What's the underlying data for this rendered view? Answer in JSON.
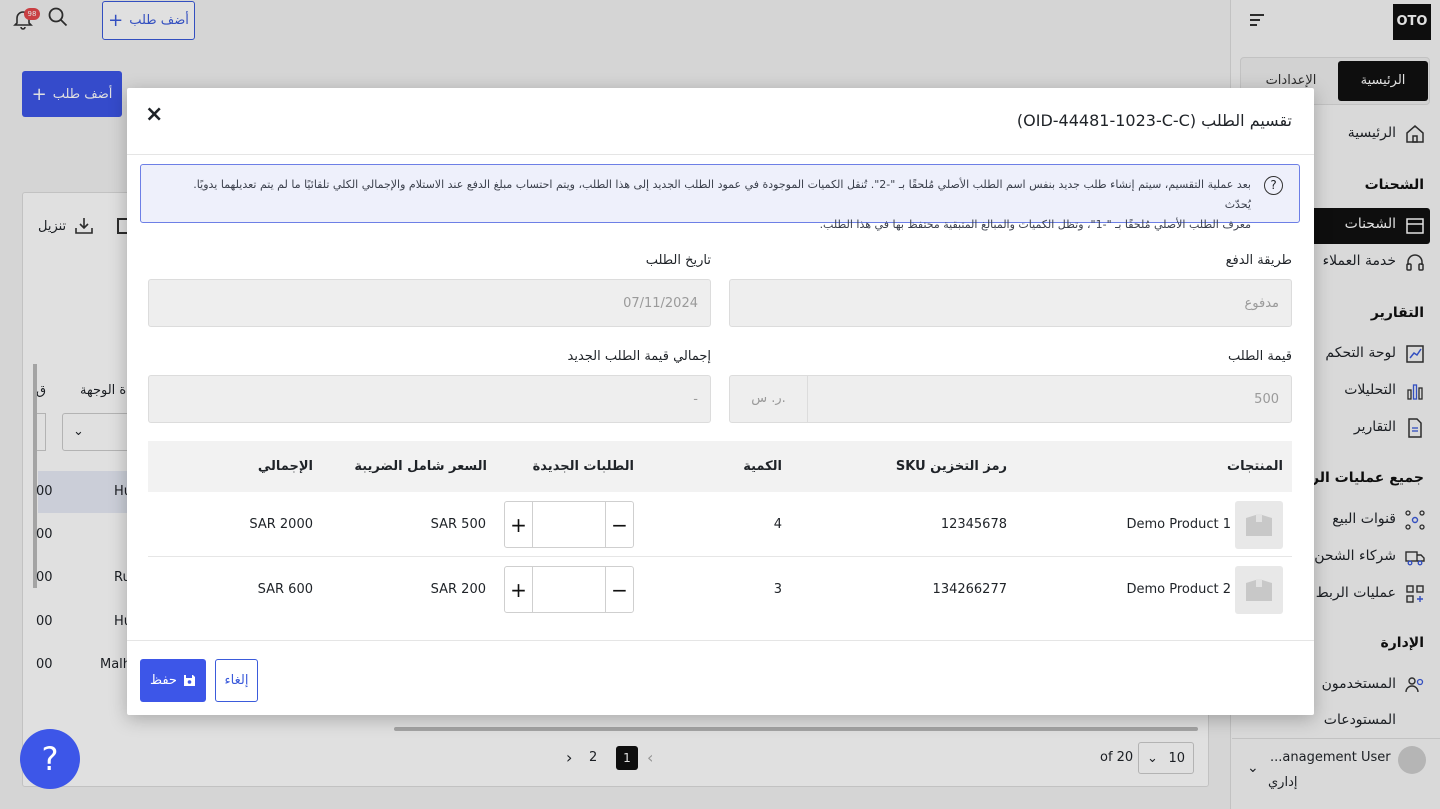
{
  "topbar": {
    "notif_count": "98",
    "add_order": "أضف طلب"
  },
  "sidebar": {
    "logo": "OTO",
    "tabs": [
      "الرئيسية",
      "الإعدادات"
    ],
    "home": "الرئيسية",
    "shipments_head": "الشحنات",
    "shipments": "الشحنات",
    "support": "خدمة العملاء",
    "reports_head": "التقارير",
    "dashboard": "لوحة التحكم",
    "analytics": "التحليلات",
    "reports": "التقارير",
    "integrations_head": "جميع عمليات الربط",
    "sales_channels": "قنوات البيع",
    "shipping_partners": "شركاء الشحن",
    "integration_ops": "عمليات الربط ا",
    "admin_head": "الإدارة",
    "users": "المستخدمون",
    "more": "المستودعات",
    "user_name": "...anagement User",
    "user_role": "إداري"
  },
  "background": {
    "add_order": "أضف طلب",
    "download": "تنزيل",
    "destination_col": "ة الوجهة",
    "partial_col": "ق",
    "rows": [
      "Hurayr",
      "",
      "Rugha",
      "Hurayr",
      "Malh"
    ],
    "row_amounts": [
      "00",
      "00",
      "00",
      "00",
      "00"
    ],
    "per_page": "10",
    "of_total": "of 20",
    "pages": [
      "1",
      "2"
    ]
  },
  "modal": {
    "title": "تقسيم الطلب (OID-44481-1023-C-C)",
    "info_line1": "بعد عملية التقسيم، سيتم إنشاء طلب جديد بنفس اسم الطلب الأصلي مُلحقًا بـ \"-2\". تُنقل الكميات الموجودة في عمود الطلب الجديد إلى هذا الطلب، ويتم احتساب مبلغ الدفع عند الاستلام والإجمالي الكلي تلقائيًا ما لم يتم تعديلهما يدويًا. يُحدّث",
    "info_line2": "معرف الطلب الأصلي مُلحقًا بـ \"-1\"، وتظل الكميات والمبالغ المتبقية محتفظ بها في هذا الطلب.",
    "payment_method_label": "طريقة الدفع",
    "payment_method_value": "مدفوع",
    "order_date_label": "تاريخ الطلب",
    "order_date_value": "07/11/2024",
    "order_value_label": "قيمة الطلب",
    "order_value": "500",
    "currency": "ر. س.",
    "new_total_label": "إجمالي قيمة الطلب الجديد",
    "new_total_value": "-",
    "columns": {
      "products": "المنتجات",
      "sku": "رمز التخزين SKU",
      "qty": "الكمية",
      "new_orders": "الطلبات الجديدة",
      "price": "السعر شامل الضريبة",
      "total": "الإجمالي"
    },
    "rows": [
      {
        "name": "Demo Product 1",
        "sku": "12345678",
        "qty": "4",
        "price": "SAR 500",
        "total": "SAR 2000"
      },
      {
        "name": "Demo Product 2",
        "sku": "134266277",
        "qty": "3",
        "price": "SAR 200",
        "total": "SAR 600"
      }
    ],
    "save": "حفظ",
    "cancel": "إلغاء"
  },
  "help": "?"
}
